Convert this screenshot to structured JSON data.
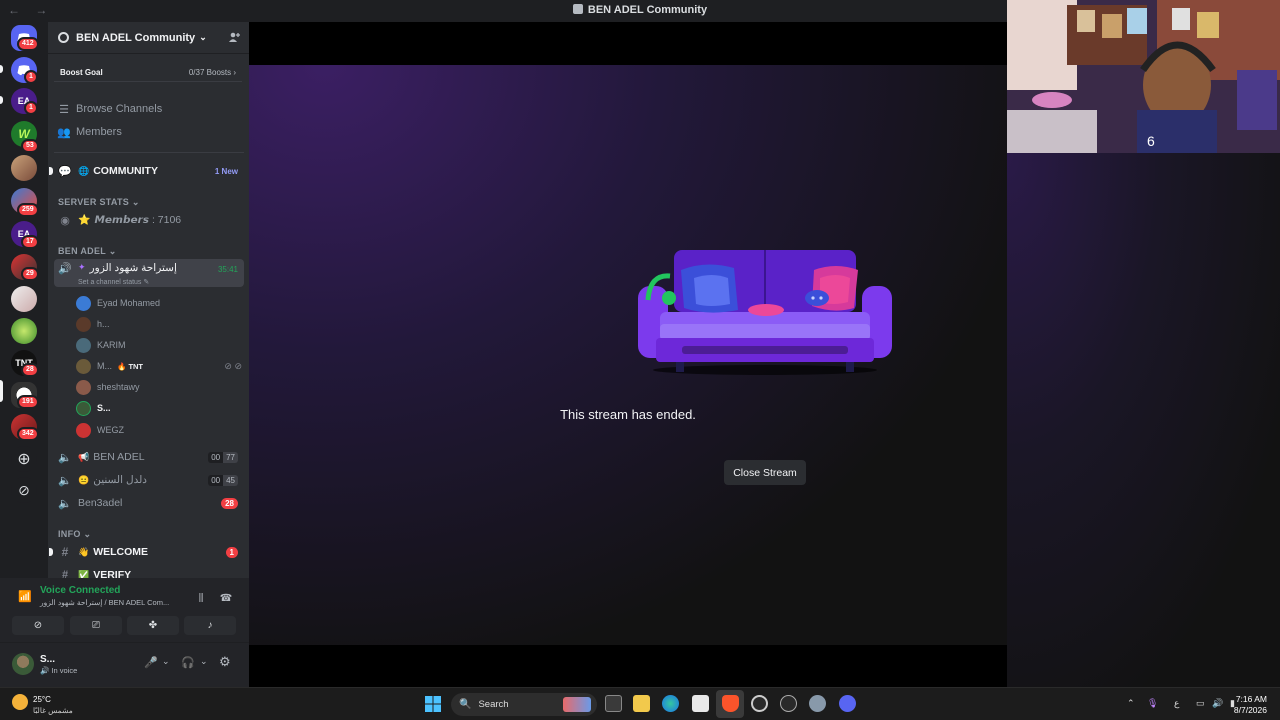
{
  "window": {
    "title": "BEN ADEL Community",
    "nav_arrows": "← →"
  },
  "rail": {
    "badges": [
      "412",
      "1",
      "1",
      "53",
      "259",
      "17",
      "29",
      "28",
      "191",
      "342"
    ],
    "server_labels": [
      "EA",
      "EA",
      "TNT"
    ]
  },
  "guild": {
    "name": "BEN ADEL Community",
    "boost_goal_label": "Boost Goal",
    "boost_count": "0/37 Boosts",
    "browse_channels": "Browse Channels",
    "members": "Members",
    "community_channel": "COMMUNITY",
    "community_new": "1 New",
    "server_stats_cat": "SERVER STATS",
    "members_stat": "𝙈𝙚𝙢𝙗𝙚𝙧𝙨 : 7106",
    "ben_adel_cat": "BEN ADEL",
    "voice_channel_name": "إستراحة شهود الزور",
    "voice_channel_timer": "35:41",
    "channel_status": "Set a channel status",
    "voice_users": [
      "Eyad Mohamed",
      "h...",
      "KARIM",
      "M...",
      "sheshtawy",
      "S...",
      "WEGZ"
    ],
    "tnt_tag": "TNT",
    "channel_ben_adel": "BEN ADEL",
    "ben_adel_counts": [
      "00",
      "77"
    ],
    "channel_arabic2": "دلدل السنين",
    "arabic2_counts": [
      "00",
      "45"
    ],
    "channel_ben3adel": "Ben3adel",
    "ben3adel_badge": "28",
    "info_cat": "INFO",
    "channel_welcome": "WELCOME",
    "welcome_badge": "1",
    "channel_verify": "VERIFY"
  },
  "voice": {
    "status": "Voice Connected",
    "location": "إستراحة شهود الزور / BEN ADEL Com..."
  },
  "user": {
    "name": "S...",
    "status": "In voice"
  },
  "stage": {
    "message": "This stream has ended.",
    "close_button": "Close Stream"
  },
  "taskbar": {
    "temperature": "25°C",
    "condition": "مشمس غالبًا",
    "search": "Search",
    "time": "7:16 AM",
    "date": "8/7/2026",
    "lang": "ع"
  },
  "colors": {
    "accent_green": "#23a55a",
    "danger_red": "#f23f43",
    "sidebar_bg": "#2b2d31",
    "rail_bg": "#1e1f22"
  }
}
